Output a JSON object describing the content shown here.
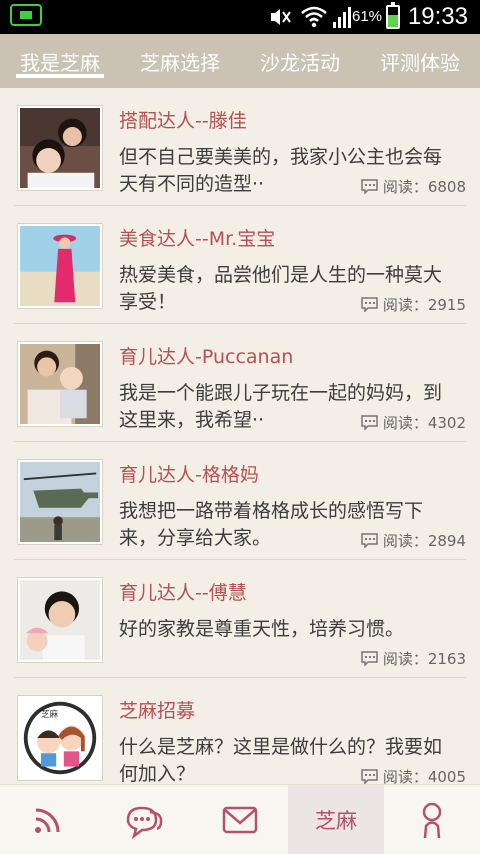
{
  "status_bar": {
    "battery_percent": "61%",
    "battery_level": 0.61,
    "time": "19:33"
  },
  "tabs": [
    {
      "label": "我是芝麻",
      "active": true
    },
    {
      "label": "芝麻选择",
      "active": false
    },
    {
      "label": "沙龙活动",
      "active": false
    },
    {
      "label": "评测体验",
      "active": false
    }
  ],
  "list": {
    "items": [
      {
        "title": "搭配达人--滕佳",
        "desc": "但不自己要美美的，我家小公主也会每天有不同的造型··",
        "reads": "阅读：6808",
        "avatar": "mother-daughter-photo"
      },
      {
        "title": "美食达人--Mr.宝宝",
        "desc": "热爱美食，品尝他们是人生的一种莫大享受！",
        "reads": "阅读：2915",
        "avatar": "pink-dress-beach-photo"
      },
      {
        "title": "育儿达人-Puccanan",
        "desc": "我是一个能跟儿子玩在一起的妈妈，到这里来，我希望··",
        "reads": "阅读：4302",
        "avatar": "mother-son-photo"
      },
      {
        "title": "育儿达人-格格妈",
        "desc": "我想把一路带着格格成长的感悟写下来，分享给大家。",
        "reads": "阅读：2894",
        "avatar": "helicopter-photo"
      },
      {
        "title": "育儿达人--傅慧",
        "desc": "好的家教是尊重天性，培养习惯。",
        "reads": "阅读：2163",
        "avatar": "mother-baby-photo"
      },
      {
        "title": "芝麻招募",
        "desc": "什么是芝麻？这里是做什么的？我要如何加入？",
        "reads": "阅读：4005",
        "avatar": "cartoon-couple-badge",
        "badge_text": "芝麻"
      }
    ]
  },
  "bottom_nav": {
    "items": [
      {
        "icon": "rss-feed-icon"
      },
      {
        "icon": "chat-bubbles-icon"
      },
      {
        "icon": "mail-icon"
      },
      {
        "label": "芝麻",
        "active": true
      },
      {
        "icon": "profile-icon"
      }
    ]
  },
  "colors": {
    "accent": "#b65052",
    "tab_bar": "#cac3b4",
    "background": "#f3efe6",
    "nav_icon": "#b4526a"
  }
}
